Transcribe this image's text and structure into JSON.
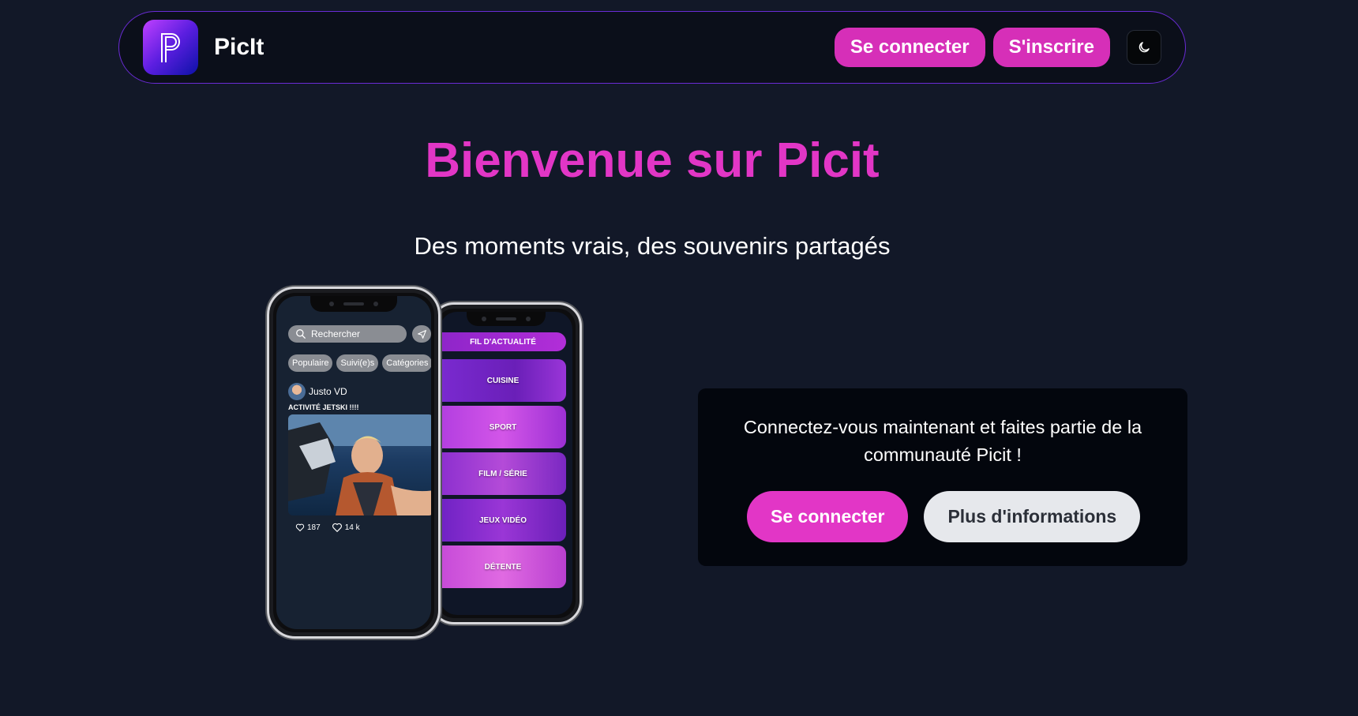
{
  "header": {
    "brand": "PicIt",
    "login_label": "Se connecter",
    "signup_label": "S'inscrire",
    "theme_icon": "moon-icon"
  },
  "hero": {
    "title": "Bienvenue sur Picit",
    "subtitle": "Des moments vrais, des souvenirs partagés"
  },
  "phone_front": {
    "search_placeholder": "Rechercher",
    "chips": [
      "Populaire",
      "Suivi(e)s",
      "Catégories"
    ],
    "post_user": "Justo VD",
    "post_caption": "ACTIVITÉ JETSKI !!!!",
    "likes": "187",
    "views": "14 k"
  },
  "phone_back": {
    "feed_label": "FIL D'ACTUALITÉ",
    "categories": [
      "CUISINE",
      "SPORT",
      "FILM / SÉRIE",
      "JEUX VIDÉO",
      "DÉTENTE"
    ]
  },
  "cta": {
    "text": "Connectez-vous maintenant et faites partie de la communauté Picit !",
    "primary_label": "Se connecter",
    "secondary_label": "Plus d'informations"
  },
  "colors": {
    "accent": "#e236c6",
    "button_pink": "#d62fb8",
    "background": "#121828"
  }
}
